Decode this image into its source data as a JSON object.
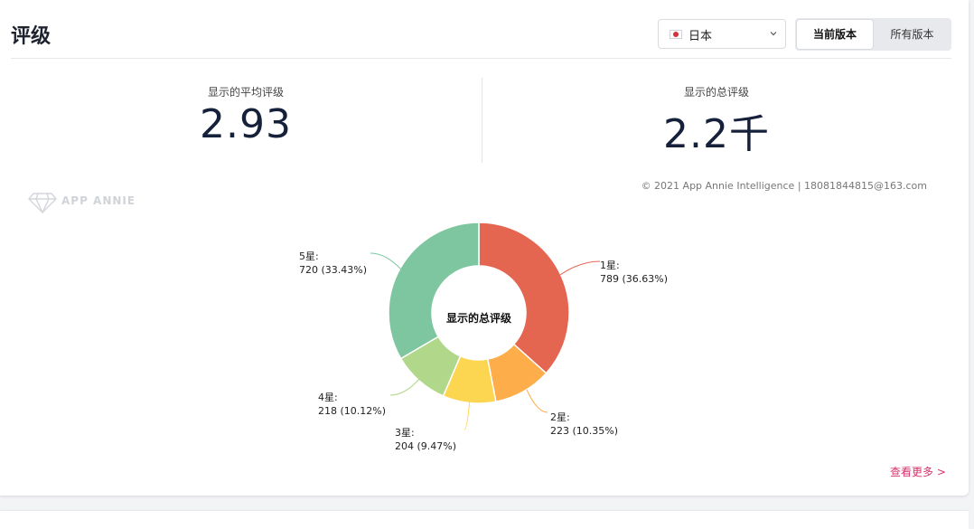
{
  "header": {
    "title": "评级",
    "country": {
      "label": "日本",
      "flag_icon": "japan-flag-icon"
    },
    "version_toggle": {
      "current": "当前版本",
      "all": "所有版本"
    }
  },
  "metrics": {
    "average": {
      "label": "显示的平均评级",
      "value": "2.93"
    },
    "total": {
      "label": "显示的总评级",
      "value": "2.2千"
    }
  },
  "copyright": "© 2021 App Annie Intelligence | 18081844815@163.com",
  "watermark": "APP ANNIE",
  "see_more": "查看更多 >",
  "colors": {
    "star1": "#e46651",
    "star2": "#fdae4b",
    "star3": "#fdd651",
    "star4": "#b1d88a",
    "star5": "#7ec6a0",
    "accent": "#d6336c"
  },
  "chart_data": {
    "type": "pie",
    "donut": true,
    "center_label": "显示的总评级",
    "slices": [
      {
        "label": "1星:",
        "value": 789,
        "percent_text": "789 (36.63%)",
        "percent": 36.63
      },
      {
        "label": "2星:",
        "value": 223,
        "percent_text": "223 (10.35%)",
        "percent": 10.35
      },
      {
        "label": "3星:",
        "value": 204,
        "percent_text": "204 (9.47%)",
        "percent": 9.47
      },
      {
        "label": "4星:",
        "value": 218,
        "percent_text": "218 (10.12%)",
        "percent": 10.12
      },
      {
        "label": "5星:",
        "value": 720,
        "percent_text": "720 (33.43%)",
        "percent": 33.43
      }
    ]
  }
}
